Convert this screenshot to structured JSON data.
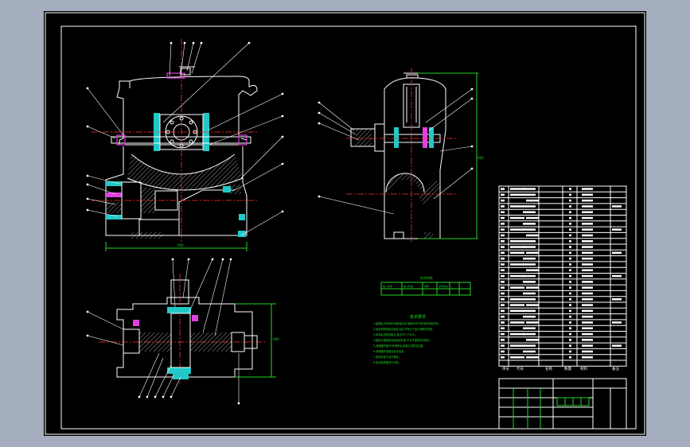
{
  "drawing": {
    "notes_title": "技术要求",
    "notes": [
      "1.装配前,所有零件用煤油清洗,箱体内不许有任何杂物存在。",
      "2.啮合侧隙用铅丝检验,铅丝不得大于最小侧隙的四倍。",
      "3.用涂色法检验斑点,斑点不少于50%。",
      "4.箱盖与箱体接合面涂密封胶,不允许使用任何垫片。",
      "5.减速器内装50号润滑油,油量达到规定高度。",
      "6.减速器外表面涂灰色油漆。",
      "7.各密封处不允许漏油。",
      "8.按试验规程进行试验。"
    ],
    "spec_title": "技术特性",
    "spec_cells": [
      "输入功率",
      "输入转速",
      "效率",
      "总传动比",
      "i",
      "n"
    ],
    "title_block_headers": [
      "序号",
      "代号",
      "名称",
      "数量",
      "材料",
      "备注"
    ]
  }
}
